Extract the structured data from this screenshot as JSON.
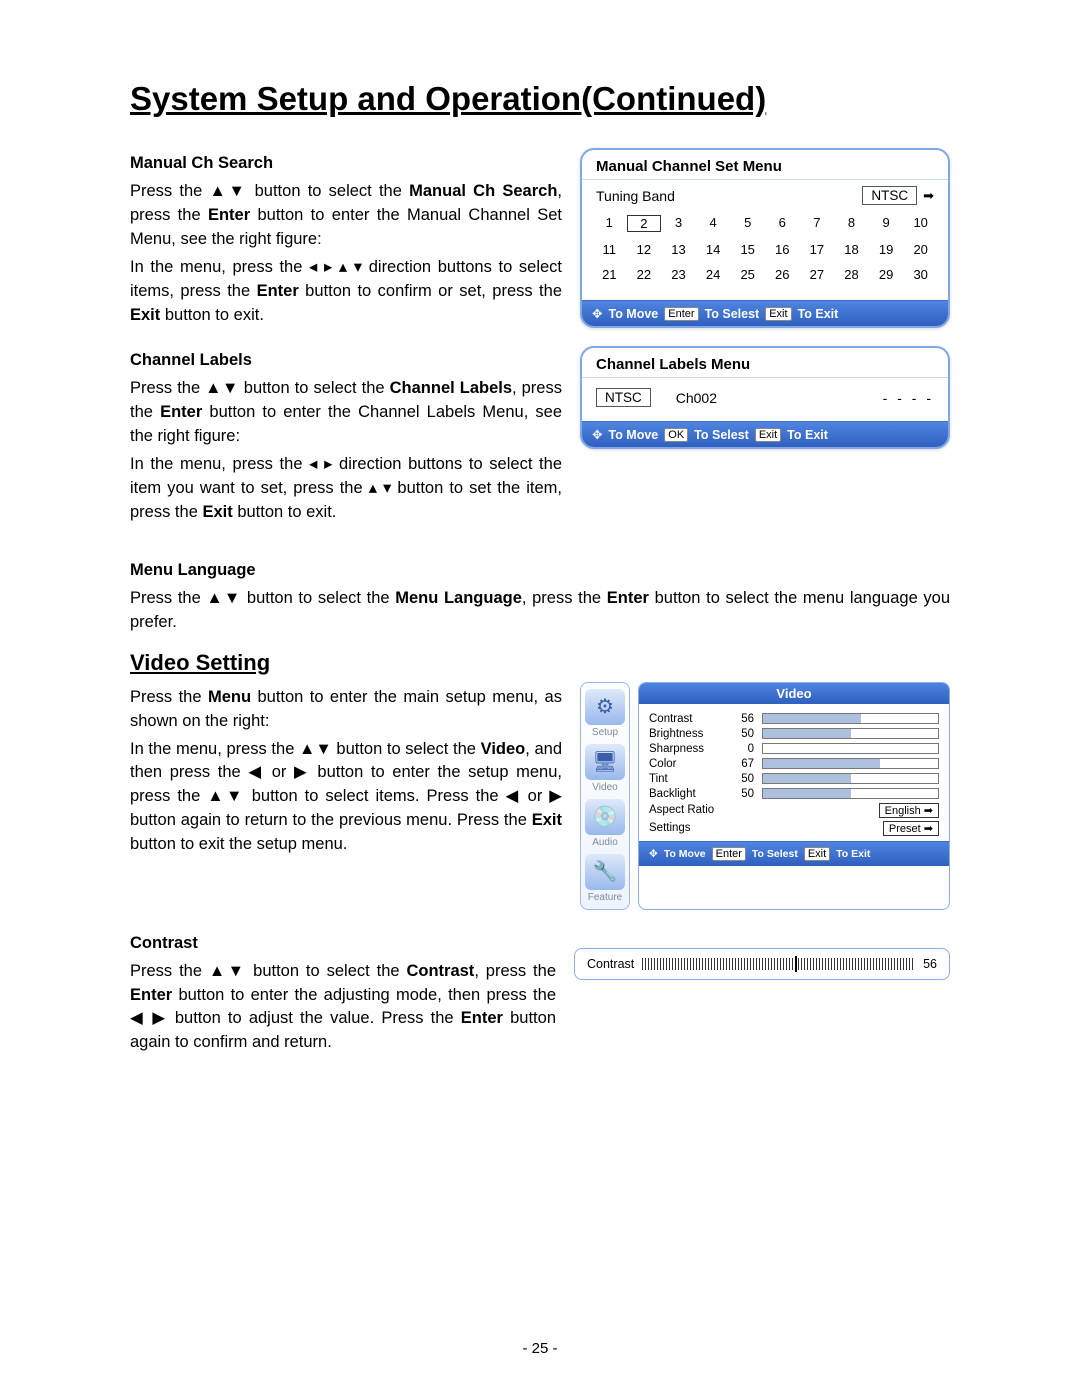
{
  "page_title": "System Setup and Operation(Continued)",
  "page_number": "- 25 -",
  "manual": {
    "heading": "Manual Ch Search",
    "p1a": "Press the ▲▼ button to select the ",
    "p1b": "Manual Ch Search",
    "p1c": ", press the ",
    "p1d": "Enter",
    "p1e": " button to enter the Manual Channel Set Menu, see the right figure:",
    "p2a": "In the menu, press the ◂ ▸ ▴ ▾ direction buttons to select items, press the ",
    "p2b": "Enter",
    "p2c": " button to confirm or set, press the ",
    "p2d": "Exit",
    "p2e": " button to exit."
  },
  "labels": {
    "heading": "Channel Labels",
    "p1a": "Press the ▲▼ button to select the ",
    "p1b": "Channel Labels",
    "p1c": ", press the ",
    "p1d": "Enter",
    "p1e": " button to enter the Channel Labels Menu, see the right figure:",
    "p2a": "In the menu, press the ◂ ▸ direction buttons to select the item you want to set, press the ▴ ▾ button to set the item, press the ",
    "p2b": "Exit",
    "p2c": " button to exit."
  },
  "lang": {
    "heading": "Menu Language",
    "p1a": "Press the ▲▼ button to select the ",
    "p1b": "Menu Language",
    "p1c": ", press the ",
    "p1d": "Enter",
    "p1e": " button to select the menu language you prefer."
  },
  "video": {
    "heading": "Video Setting",
    "p1a": "Press the ",
    "p1b": "Menu",
    "p1c": " button to enter the main setup menu, as shown on the right:",
    "p2a": "In the menu, press the ▲▼ button to select the ",
    "p2b": "Video",
    "p2c": ", and then press the ◀ or ▶ button to enter the setup menu, press the ▲▼ button to select items. Press the ◀ or ▶ button again to return to the previous menu. Press the ",
    "p2d": "Exit",
    "p2e": " button to exit the setup menu."
  },
  "contrast": {
    "heading": "Contrast",
    "p1a": "Press the ▲▼ button to select the ",
    "p1b": "Contrast",
    "p1c": ", press the ",
    "p1d": "Enter",
    "p1e": " button to enter the adjusting mode, then press the ◀ ▶ button to adjust the value. Press the ",
    "p1f": "Enter",
    "p1g": " button again to confirm and return."
  },
  "fig_manual": {
    "title": "Manual Channel Set Menu",
    "tuning_label": "Tuning Band",
    "ntsc": "NTSC",
    "channels": [
      "1",
      "2",
      "3",
      "4",
      "5",
      "6",
      "7",
      "8",
      "9",
      "10",
      "11",
      "12",
      "13",
      "14",
      "15",
      "16",
      "17",
      "18",
      "19",
      "20",
      "21",
      "22",
      "23",
      "24",
      "25",
      "26",
      "27",
      "28",
      "29",
      "30"
    ],
    "selected_index": 1,
    "footer": {
      "move": "To Move",
      "enter_tag": "Enter",
      "select": "To Selest",
      "exit_tag": "Exit",
      "exit": "To Exit"
    }
  },
  "fig_labels": {
    "title": "Channel Labels Menu",
    "ntsc": "NTSC",
    "ch": "Ch002",
    "dashes": "- - - -",
    "footer": {
      "move": "To Move",
      "ok_tag": "OK",
      "select": "To Selest",
      "exit_tag": "Exit",
      "exit": "To Exit"
    }
  },
  "fig_video": {
    "title": "Video",
    "side": [
      {
        "name": "Setup",
        "glyph": "⚙"
      },
      {
        "name": "Video",
        "glyph": "🖥"
      },
      {
        "name": "Audio",
        "glyph": "💿"
      },
      {
        "name": "Feature",
        "glyph": "🔧"
      }
    ],
    "rows": [
      {
        "label": "Contrast",
        "value": 56
      },
      {
        "label": "Brightness",
        "value": 50
      },
      {
        "label": "Sharpness",
        "value": 0
      },
      {
        "label": "Color",
        "value": 67
      },
      {
        "label": "Tint",
        "value": 50
      },
      {
        "label": "Backlight",
        "value": 50
      }
    ],
    "aspect_label": "Aspect Ratio",
    "aspect_value": "English",
    "settings_label": "Settings",
    "settings_value": "Preset",
    "footer": {
      "move": "To Move",
      "enter_tag": "Enter",
      "select": "To Selest",
      "exit_tag": "Exit",
      "exit": "To Exit"
    }
  },
  "fig_contrast": {
    "label": "Contrast",
    "value": 56
  }
}
